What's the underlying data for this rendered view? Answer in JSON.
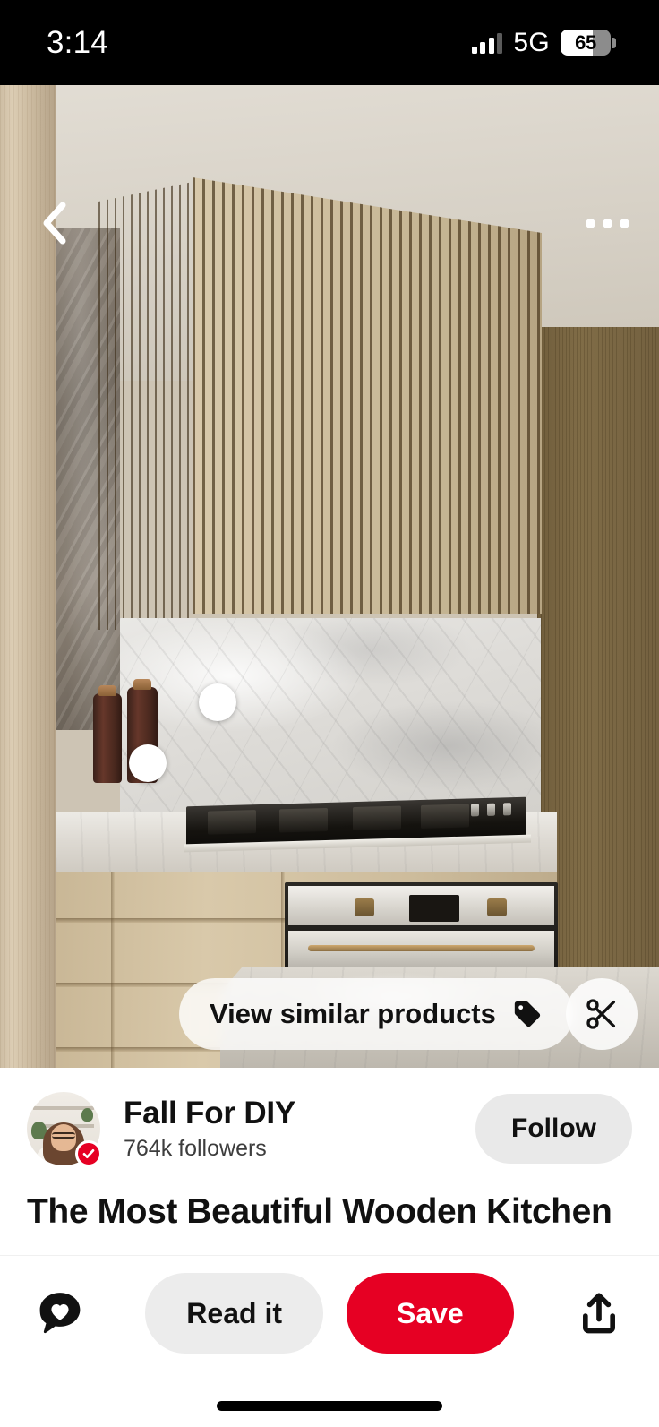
{
  "status_bar": {
    "time": "3:14",
    "network_label": "5G",
    "battery_percent": "65",
    "signal_icon": "cellular-signal-icon",
    "battery_icon": "battery-icon"
  },
  "pin_media": {
    "alt": "Modern kitchen with slatted wooden extractor hood, marble backsplash, black gas cooktop and light oak cabinetry",
    "back_icon": "chevron-left-icon",
    "more_icon": "overflow-menu-icon",
    "product_tag_dots": 2,
    "overlay": {
      "view_similar_label": "View similar products",
      "view_similar_icon": "price-tag-icon",
      "scissors_icon": "scissors-icon"
    },
    "colors": {
      "ceiling": "#ddd7cd",
      "slat_wood": "#cfbf9f",
      "right_wall_wood": "#7d6943",
      "marble": "#e4e2de",
      "cabinet_oak": "#d2c1a1",
      "cooktop_black": "#15130f"
    }
  },
  "creator": {
    "name": "Fall For DIY",
    "followers": "764k followers",
    "verified": true,
    "verified_icon": "verified-check-icon",
    "avatar_icon": "avatar",
    "follow_label": "Follow"
  },
  "pin": {
    "title": "The Most Beautiful Wooden Kitchen"
  },
  "action_bar": {
    "react_icon": "comment-heart-icon",
    "read_it_label": "Read it",
    "save_label": "Save",
    "share_icon": "share-icon",
    "save_color": "#e60023",
    "read_it_color": "#ececec"
  },
  "system": {
    "home_indicator": "home-indicator"
  }
}
